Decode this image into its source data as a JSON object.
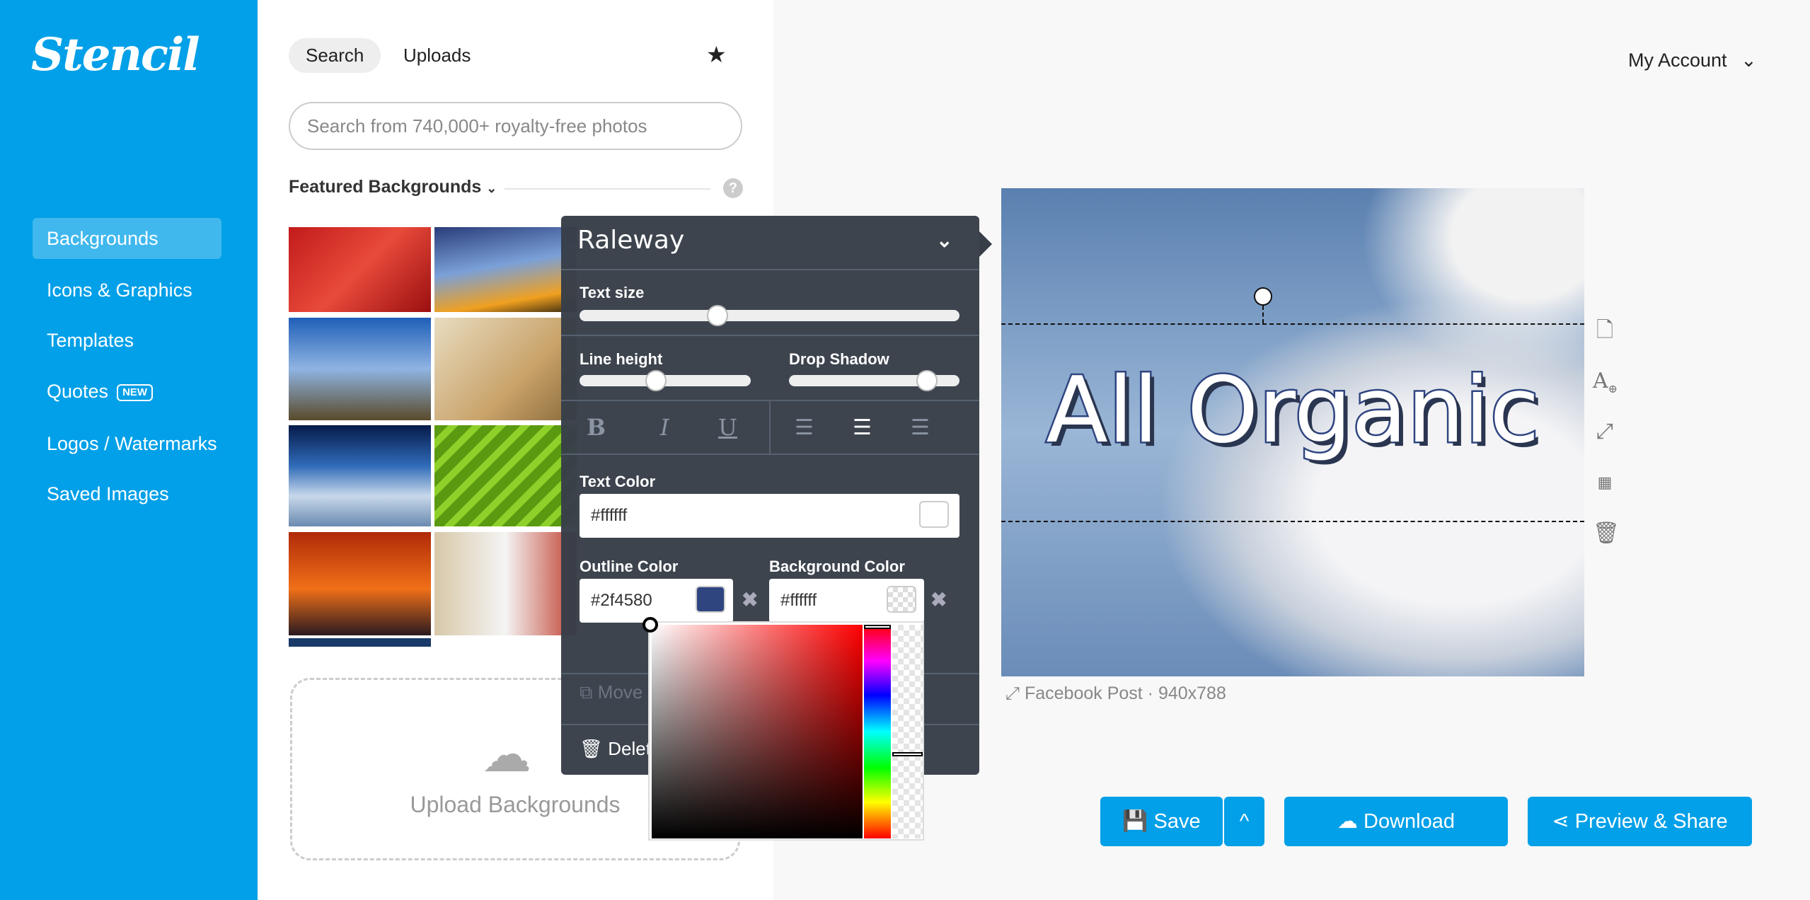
{
  "brand": {
    "logo": "Stencil",
    "color": "#01a0e8"
  },
  "sidebar": {
    "items": [
      {
        "label": "Backgrounds",
        "active": true
      },
      {
        "label": "Icons & Graphics"
      },
      {
        "label": "Templates"
      },
      {
        "label": "Quotes",
        "badge": "NEW"
      },
      {
        "label": "Logos / Watermarks"
      },
      {
        "label": "Saved Images"
      }
    ]
  },
  "panel": {
    "tabs": [
      {
        "label": "Search",
        "active": true
      },
      {
        "label": "Uploads"
      }
    ],
    "favorites_icon": "star-icon",
    "search_placeholder": "Search from 740,000+ royalty-free photos",
    "section_title": "Featured Backgrounds",
    "help_icon": "question-icon",
    "upload_label": "Upload Backgrounds"
  },
  "text_panel": {
    "font": "Raleway",
    "text_size_label": "Text size",
    "text_size_value": 0.36,
    "line_height_label": "Line height",
    "line_height_value": 0.44,
    "drop_shadow_label": "Drop Shadow",
    "drop_shadow_value": 0.8,
    "format": {
      "bold": "B",
      "italic": "I",
      "underline": "U"
    },
    "alignment": "center",
    "text_color_label": "Text Color",
    "text_color": "#ffffff",
    "outline_color_label": "Outline Color",
    "outline_color": "#2f4580",
    "background_color_label": "Background Color",
    "background_color": "#ffffff",
    "move_label": "Move",
    "delete_label": "Delete"
  },
  "canvas": {
    "text": "All Organic",
    "size_label": "Facebook Post · 940x788"
  },
  "header": {
    "account": "My Account"
  },
  "actions": {
    "save": "Save",
    "download": "Download",
    "share": "Preview & Share"
  }
}
